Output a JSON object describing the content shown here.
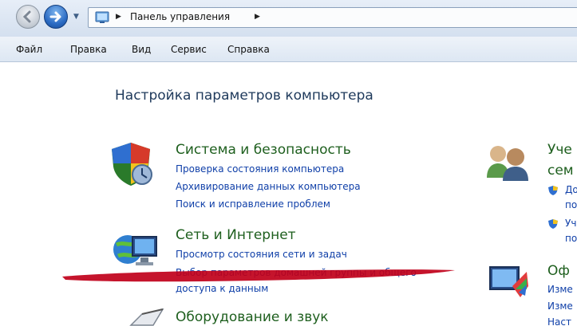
{
  "address_bar": {
    "breadcrumb": [
      "Панель управления"
    ]
  },
  "menu": {
    "items": [
      "Файл",
      "Правка",
      "Вид",
      "Сервис",
      "Справка"
    ]
  },
  "page": {
    "title": "Настройка параметров компьютера"
  },
  "categories_left": [
    {
      "title": "Система и безопасность",
      "icon": "shield-icon",
      "links": [
        "Проверка состояния компьютера",
        "Архивирование данных компьютера",
        "Поиск и исправление проблем"
      ]
    },
    {
      "title": "Сеть и Интернет",
      "icon": "network-icon",
      "links": [
        "Просмотр состояния сети и задач",
        "Выбор параметров домашней группы и общего",
        "доступа к данным"
      ]
    },
    {
      "title": "Оборудование и звук",
      "icon": "hardware-icon",
      "links": []
    }
  ],
  "categories_right": [
    {
      "title_line1": "Уче",
      "title_line2": "сем",
      "icon": "users-icon",
      "sublinks": [
        "До",
        "по",
        "Уч",
        "по"
      ]
    },
    {
      "title": "Оф",
      "icon": "appearance-icon",
      "links": [
        "Изме",
        "Изме",
        "Наст"
      ]
    }
  ],
  "colors": {
    "accent_link": "#0f3fa8",
    "category_title": "#1e5f1e",
    "scribble": "#c0001a"
  }
}
